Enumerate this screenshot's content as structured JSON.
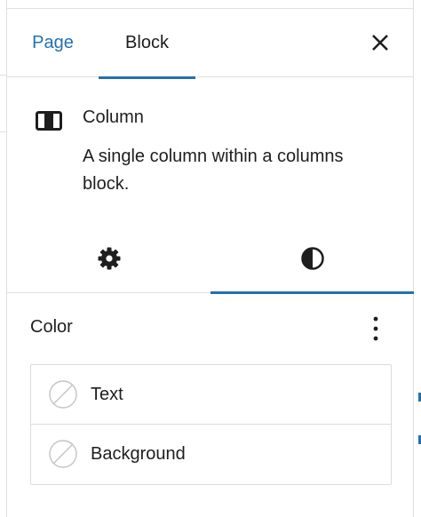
{
  "header": {
    "tabs": [
      {
        "label": "Page",
        "active": false
      },
      {
        "label": "Block",
        "active": true
      }
    ],
    "close_icon": "close-icon"
  },
  "block_card": {
    "icon": "column-block-icon",
    "title": "Column",
    "description": "A single column within a columns block."
  },
  "inspector_tabs": [
    {
      "icon": "gear-icon",
      "active": false
    },
    {
      "icon": "half-circle-styles-icon",
      "active": true
    }
  ],
  "color_panel": {
    "heading": "Color",
    "options_icon": "more-vertical-icon",
    "items": [
      {
        "label": "Text",
        "swatch": "no-color-swatch-icon"
      },
      {
        "label": "Background",
        "swatch": "no-color-swatch-icon"
      }
    ]
  },
  "colors": {
    "accent": "#2271b1",
    "text": "#1e1e1e",
    "border": "#e0e0e0"
  }
}
